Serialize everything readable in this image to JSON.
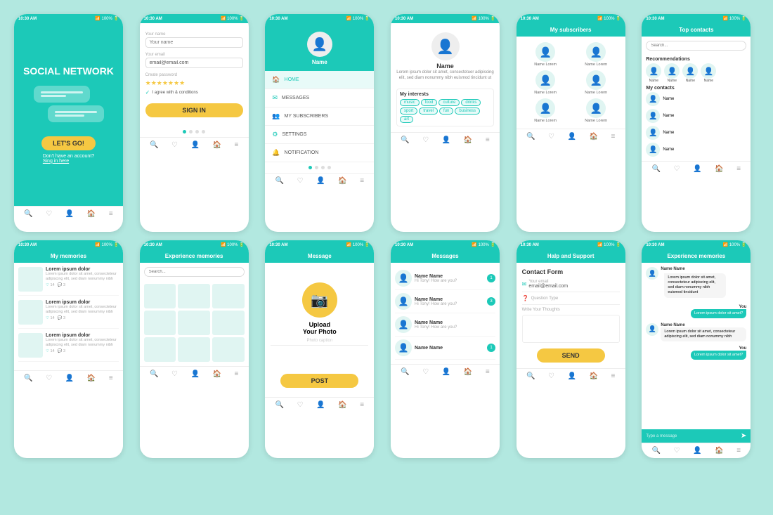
{
  "bg_color": "#b2e8e0",
  "teal": "#1cc9b8",
  "yellow": "#f5c842",
  "phones": [
    {
      "id": "phone-1",
      "title": "SOCIAL NETWORK",
      "btn": "LET'S GO!",
      "sub1": "Don't have an account?",
      "sub2": "Sing in here",
      "status": "10:30 AM",
      "battery": "100%"
    },
    {
      "id": "phone-2",
      "label1": "Your name",
      "placeholder1": "Your name",
      "label2": "Your email",
      "placeholder2": "email@email.com",
      "label3": "Create password",
      "agree": "I agree with & conditions",
      "btn": "SIGN IN",
      "status": "10:30 AM"
    },
    {
      "id": "phone-3",
      "avatar_name": "Name",
      "menu": [
        "HOME",
        "MESSAGES",
        "MY SUBSCRIBERS",
        "SETTINGS",
        "NOTIFICATION"
      ],
      "menu_active": 0,
      "status": "10:30 AM"
    },
    {
      "id": "phone-4",
      "name": "Name",
      "bio": "Lorem ipsum dolor sit amet, consectetuer adipiscing elit, sed diam nonummy nibh euismod tincidunt ut",
      "interests_title": "My interests",
      "tags": [
        "music",
        "food",
        "culture",
        "drinks",
        "sport",
        "travel",
        "fun",
        "business",
        "art"
      ],
      "status": "10:30 AM"
    },
    {
      "id": "phone-5",
      "header": "My subscribers",
      "subscribers": [
        "Name Lorem",
        "Name Lorem",
        "Name Lorem",
        "Name Lorem",
        "Name Lorem",
        "Name Lorem"
      ],
      "status": "10:30 AM"
    },
    {
      "id": "phone-6",
      "header": "Top contacts",
      "search_placeholder": "Search...",
      "rec_title": "Recommendations",
      "rec_names": [
        "Name",
        "Name",
        "Name",
        "Name"
      ],
      "contacts_title": "My contacts",
      "contacts": [
        "Name",
        "Name",
        "Name",
        "Name"
      ],
      "status": "10:30 AM"
    },
    {
      "id": "phone-7",
      "header": "My memories",
      "items": [
        {
          "title": "Lorem ipsum dolor",
          "text": "Lorem ipsum dolor sit amet, consecteteur adipiscing elit, sed diam nonummy nibh",
          "likes": "14",
          "comments": "3"
        },
        {
          "title": "Lorem ipsum dolor",
          "text": "Lorem ipsum dolor sit amet, consecteteur adipiscing elit, sed diam nonummy nibh",
          "likes": "14",
          "comments": "3"
        },
        {
          "title": "Lorem ipsum dolor",
          "text": "Lorem ipsum dolor sit amet, consecteteur adipiscing elit, sed diam nonummy nibh",
          "likes": "14",
          "comments": "3"
        }
      ],
      "status": "10:30 AM"
    },
    {
      "id": "phone-8",
      "header": "Experience memories",
      "search_placeholder": "Search...",
      "status": "10:30 AM"
    },
    {
      "id": "phone-9",
      "header": "Message",
      "upload_text": "Upload\nYour Photo",
      "caption": "Photo caption",
      "btn": "POST",
      "status": "10:30 AM"
    },
    {
      "id": "phone-10",
      "header": "Messages",
      "messages": [
        {
          "name": "Name Name",
          "preview": "Hi Tony! How are you?",
          "badge": "1"
        },
        {
          "name": "Name Name",
          "preview": "Hi Tony! How are you?",
          "badge": "3"
        },
        {
          "name": "Name Name",
          "preview": "Hi Tony! How are you?",
          "badge": ""
        },
        {
          "name": "Name Name",
          "preview": "",
          "badge": "1"
        }
      ],
      "status": "10:30 AM"
    },
    {
      "id": "phone-11",
      "header": "Halp and Support",
      "form_title": "Contact Form",
      "email_label": "Your email",
      "email_value": "email@email.com",
      "question_label": "Question Type",
      "thoughts_label": "Write Your Thoughts",
      "btn": "SEND",
      "status": "10:30 AM"
    },
    {
      "id": "phone-12",
      "header": "Experience memories",
      "messages": [
        {
          "side": "left",
          "sender": "Name Name",
          "text": "Lorem ipsum dolor sit amet, consecteteur adipiscing elit, sed diam nonummy nibh euismod tincidunt"
        },
        {
          "side": "right",
          "sender": "You",
          "text": "Lorem ipsum dolor sit amet?"
        },
        {
          "side": "left",
          "sender": "Name Name",
          "text": "Lorem ipsum dolor sit amet, consecteteur adipiscing elit, sed diam nonummy nibh"
        },
        {
          "side": "right",
          "sender": "You",
          "text": "Lorem ipsum dolor sit amet?"
        }
      ],
      "input_placeholder": "Type a message",
      "status": "10:30 AM"
    }
  ],
  "nav_icons": [
    "🔍",
    "♡",
    "👤",
    "🏠",
    "≡"
  ]
}
